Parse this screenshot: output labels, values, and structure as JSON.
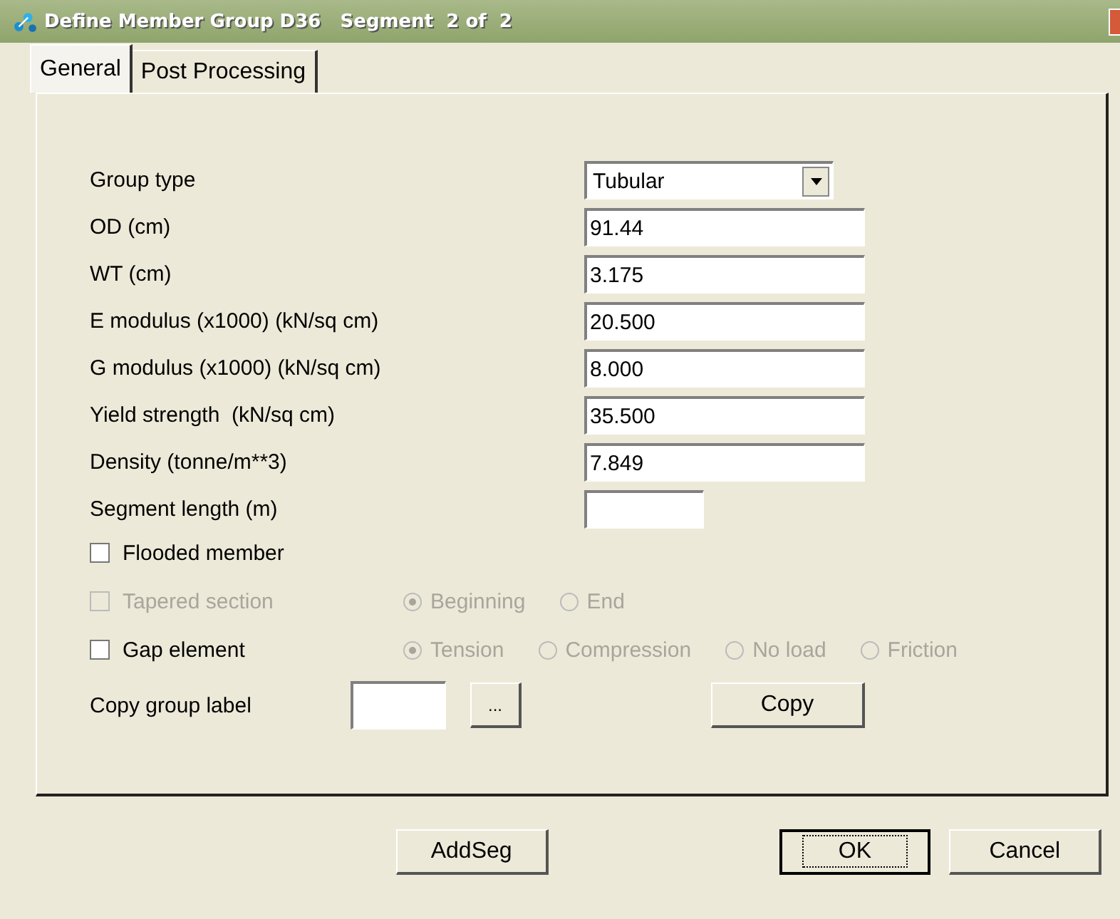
{
  "window": {
    "title": "Define Member Group D36   Segment  2 of  2"
  },
  "tabs": [
    {
      "label": "General",
      "selected": true
    },
    {
      "label": "Post Processing",
      "selected": false
    }
  ],
  "fields": [
    {
      "label": "Group type",
      "kind": "dropdown",
      "value": "Tubular"
    },
    {
      "label": "OD (cm)",
      "kind": "text",
      "value": "91.44"
    },
    {
      "label": "WT (cm)",
      "kind": "text",
      "value": "3.175"
    },
    {
      "label": "E modulus (x1000) (kN/sq cm)",
      "kind": "text",
      "value": "20.500"
    },
    {
      "label": "G modulus (x1000) (kN/sq cm)",
      "kind": "text",
      "value": "8.000"
    },
    {
      "label": "Yield strength  (kN/sq cm)",
      "kind": "text",
      "value": "35.500"
    },
    {
      "label": "Density (tonne/m**3)",
      "kind": "text",
      "value": "7.849"
    },
    {
      "label": "Segment length (m)",
      "kind": "short"
    }
  ],
  "options": [
    {
      "label": "Flooded member",
      "checked": false,
      "disabled": false
    },
    {
      "label": "Tapered section",
      "checked": false,
      "disabled": true,
      "radios": [
        {
          "label": "Beginning",
          "selected": true,
          "disabled": true
        },
        {
          "label": "End",
          "selected": false,
          "disabled": true
        }
      ]
    },
    {
      "label": "Gap element",
      "checked": false,
      "disabled": false,
      "radios": [
        {
          "label": "Tension",
          "selected": true,
          "disabled": true
        },
        {
          "label": "Compression",
          "selected": false,
          "disabled": true
        },
        {
          "label": "No load",
          "selected": false,
          "disabled": true
        },
        {
          "label": "Friction",
          "selected": false,
          "disabled": true
        }
      ]
    }
  ],
  "copy_row": {
    "label": "Copy group label",
    "browse": "...",
    "button": "Copy"
  },
  "buttons": [
    {
      "label": "AddSeg",
      "default": false
    },
    {
      "label": "OK",
      "default": true
    },
    {
      "label": "Cancel",
      "default": false
    }
  ]
}
